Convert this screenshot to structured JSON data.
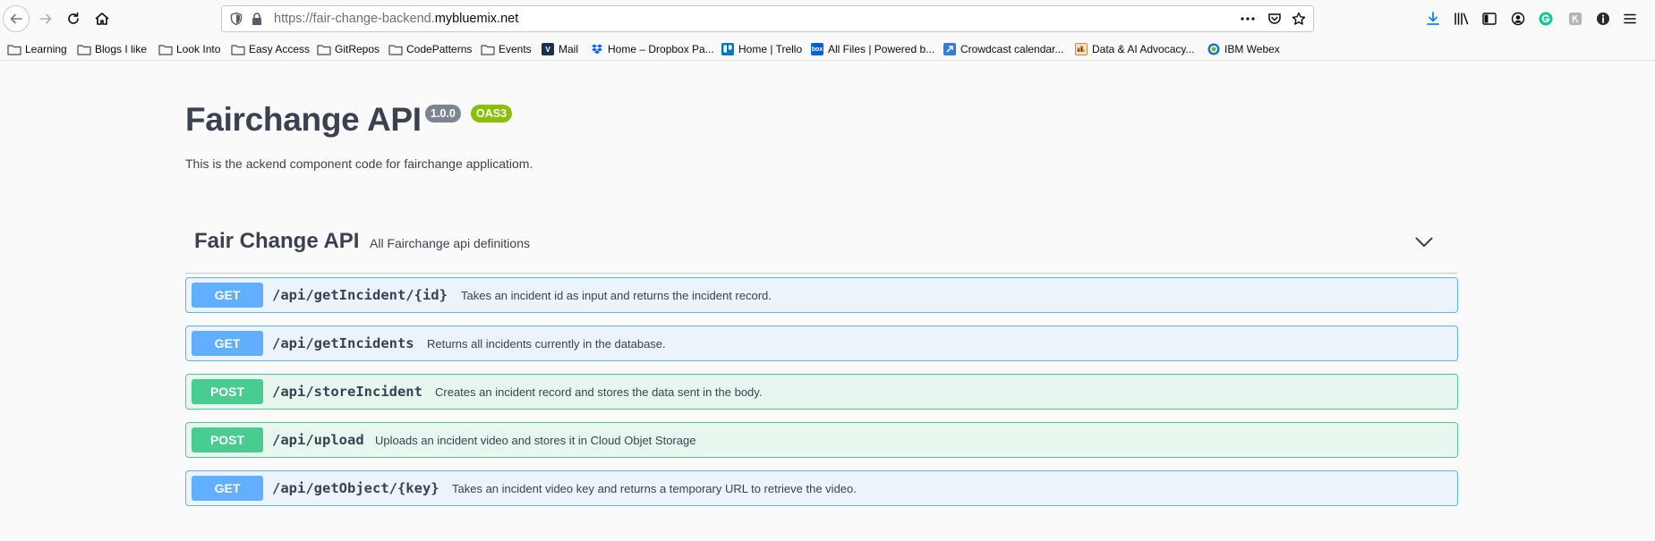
{
  "browser": {
    "url_prefix": "https://fair-change-backend.",
    "url_host": "mybluemix.net",
    "bookmarks": [
      {
        "label": "Learning",
        "icon": "folder-icon"
      },
      {
        "label": "Blogs I like",
        "icon": "folder-icon"
      },
      {
        "label": "Look Into",
        "icon": "folder-icon"
      },
      {
        "label": "Easy Access",
        "icon": "folder-icon"
      },
      {
        "label": "GitRepos",
        "icon": "folder-icon"
      },
      {
        "label": "CodePatterns",
        "icon": "folder-icon"
      },
      {
        "label": "Events",
        "icon": "folder-icon"
      },
      {
        "label": "Mail",
        "icon": "mail-favicon"
      },
      {
        "label": "Home – Dropbox Pa...",
        "icon": "dropbox-favicon"
      },
      {
        "label": "Home | Trello",
        "icon": "trello-favicon"
      },
      {
        "label": "All Files | Powered b...",
        "icon": "box-favicon"
      },
      {
        "label": "Crowdcast calendar...",
        "icon": "crowdcast-favicon"
      },
      {
        "label": "Data & AI Advocacy...",
        "icon": "advocacy-favicon"
      },
      {
        "label": "IBM Webex",
        "icon": "webex-favicon"
      }
    ],
    "favicon_text": {
      "box": "box"
    }
  },
  "api": {
    "title": "Fairchange API",
    "version": "1.0.0",
    "oas": "OAS3",
    "description": "This is the ackend component code for fairchange applicatiom."
  },
  "tag": {
    "name": "Fair Change API",
    "description": "All Fairchange api definitions"
  },
  "operations": [
    {
      "method": "GET",
      "path": "/api/getIncident/{id}",
      "summary": "Takes an incident id as input and returns the incident record."
    },
    {
      "method": "GET",
      "path": "/api/getIncidents",
      "summary": "Returns all incidents currently in the database."
    },
    {
      "method": "POST",
      "path": "/api/storeIncident",
      "summary": "Creates an incident record and stores the data sent in the body."
    },
    {
      "method": "POST",
      "path": "/api/upload",
      "summary": "Uploads an incident video and stores it in Cloud Objet Storage"
    },
    {
      "method": "GET",
      "path": "/api/getObject/{key}",
      "summary": "Takes an incident video key and returns a temporary URL to retrieve the video."
    }
  ],
  "colors": {
    "get": "#61affe",
    "post": "#49cc90",
    "version_badge": "#7d8492",
    "oas_badge": "#89bf04",
    "text": "#3b4151"
  }
}
